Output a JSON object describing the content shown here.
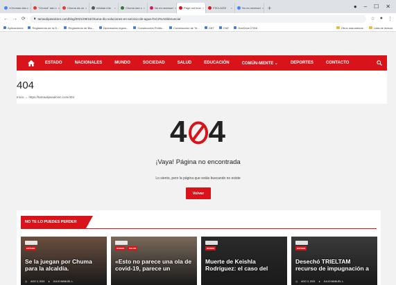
{
  "browser": {
    "tabs": [
      {
        "label": "«Chumas dan c",
        "color": "#4285f4",
        "active": false
      },
      {
        "label": "\"Chuma\" dan c",
        "color": "#e53935",
        "active": false
      },
      {
        "label": "Chuma da un",
        "color": "#e53935",
        "active": false
      },
      {
        "label": "Infobae.info",
        "color": "#555555",
        "active": false
      },
      {
        "label": "Chuma dan c",
        "color": "#2e7d32",
        "active": false
      },
      {
        "label": "No es necesari",
        "color": "#d81b60",
        "active": false
      },
      {
        "label": "Page not foun",
        "color": "#d8131a",
        "active": true
      },
      {
        "label": "FSCLAZDI",
        "color": "#d8131a",
        "active": false
      },
      {
        "label": "No es necesari",
        "color": "#4285f4",
        "active": false
      }
    ],
    "new_tab": "+",
    "url": "tamaulipasalcien.com/blog/2021/08/16/chuma-dio-soluciones-en-servicio-de-agua-/%C2%A0/denuncia/",
    "bookmarks": [
      "Aplicaciones",
      "Reglamento de la O...",
      "Reglamento de Bla...",
      "Diplomados Ingres...",
      "Construcción Polític...",
      "Construcción de Te...",
      "CBT",
      "CNE",
      "OneDrive DTAK"
    ],
    "bookmarks_right": [
      "Otros marcadores",
      "Lista de lectura"
    ]
  },
  "nav": {
    "items": [
      "ESTADO",
      "NACIONALES",
      "MUNDO",
      "SOCIEDAD",
      "SALUD",
      "EDUCACIÓN",
      "COMÚN-MENTE ⌄",
      "DEPORTES",
      "CONTACTO"
    ]
  },
  "header": {
    "title": "404",
    "breadcrumb": "Inicio → https://tamaulipasalcien.com/404"
  },
  "error": {
    "left": "4",
    "right": "4",
    "heading": "¡Vaya! Página no encontrada",
    "message": "Lo siento, pero la página que estás buscando no existe",
    "button": "Volver"
  },
  "section": {
    "title": "NO TE LO PUEDES PERDER",
    "cards": [
      {
        "tag": "ESTADO",
        "tag2": "",
        "headline": "Se la juegan por Chuma para la alcaldía.",
        "date": "AGO 3, 2021",
        "author": "JULIO MANUEL L.",
        "bg": "#6b5040"
      },
      {
        "tag": "MUNDO",
        "tag2": "SALUD",
        "headline": "«Esto no parece una ola de covid-19, parece un",
        "date": "",
        "author": "",
        "bg": "#7a6a5a"
      },
      {
        "tag": "MUNDO",
        "tag2": "",
        "headline": "Muerte de Keishla Rodríguez: el caso del",
        "date": "",
        "author": "",
        "bg": "#2a2a2a"
      },
      {
        "tag": "ESTADO",
        "tag2": "",
        "headline": "Desechó TRIELTAM recurso de impugnación a",
        "date": "AGO 3, 2021",
        "author": "JULIO MANUEL L.",
        "bg": "#3a3a3a"
      }
    ]
  }
}
